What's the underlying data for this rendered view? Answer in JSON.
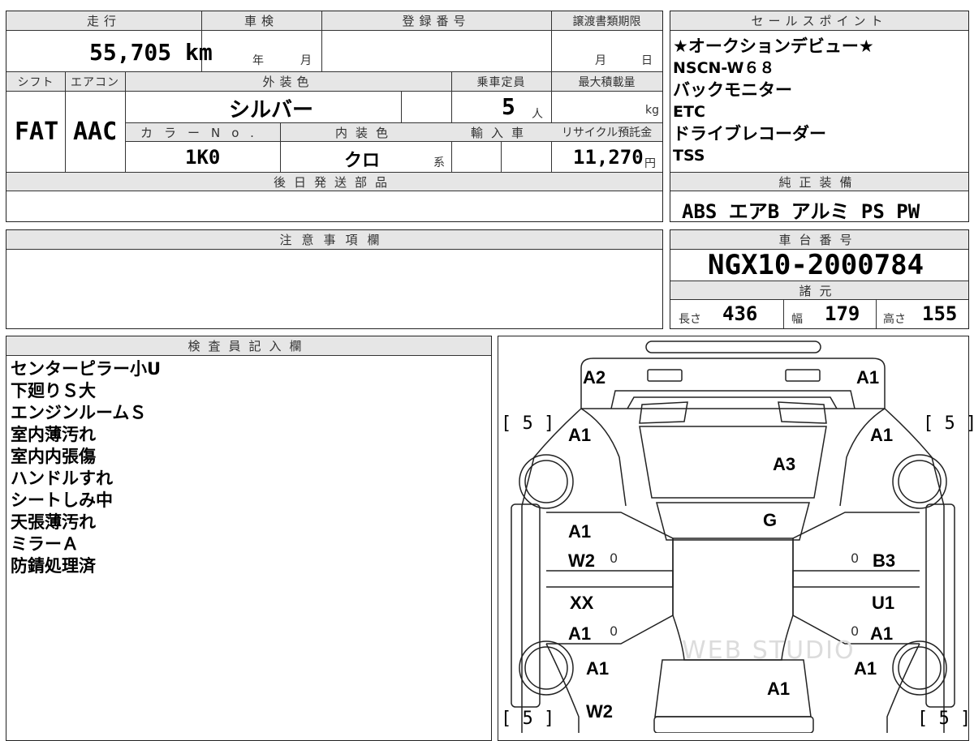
{
  "top": {
    "mileage_header": "走行",
    "shaken_header": "車検",
    "registration_header": "登録番号",
    "transfer_deadline_header": "譲渡書類期限",
    "mileage_value": "55,705 km",
    "shaken_year": "年",
    "shaken_month": "月",
    "transfer_month": "月",
    "transfer_day": "日",
    "shift_header": "シフト",
    "aircon_header": "エアコン",
    "exterior_color_header": "外装色",
    "capacity_header": "乗車定員",
    "max_load_header": "最大積載量",
    "shift_value": "FAT",
    "aircon_value": "AAC",
    "exterior_color_value": "シルバー",
    "capacity_value": "5",
    "capacity_unit": "人",
    "max_load_unit": "kg",
    "color_no_header": "カラーNo.",
    "interior_color_header": "内装色",
    "import_header": "輸入車",
    "recycle_header": "リサイクル預託金",
    "color_no_value": "1K0",
    "interior_color_value": "クロ",
    "interior_color_suffix": "系",
    "recycle_value": "11,270",
    "recycle_unit": "円",
    "later_parts_header": "後日発送部品"
  },
  "sales_points": {
    "header": "セールスポイント",
    "items": [
      "★オークションデビュー★",
      "NSCN-W６８",
      "バックモニター",
      "ETC",
      "ドライブレコーダー",
      "TSS"
    ]
  },
  "equipment": {
    "header": "純正装備",
    "value": "ABS エアB アルミ PS PW"
  },
  "notes": {
    "header": "注意事項欄"
  },
  "chassis": {
    "header": "車台番号",
    "value": "NGX10-2000784",
    "specs_header": "諸元",
    "length_label": "長さ",
    "length_value": "436",
    "width_label": "幅",
    "width_value": "179",
    "height_label": "高さ",
    "height_value": "155"
  },
  "inspector": {
    "header": "検査員記入欄",
    "lines": [
      "センターピラー小U",
      "下廻りＳ大",
      "エンジンルームＳ",
      "室内薄汚れ",
      "室内内張傷",
      "ハンドルすれ",
      "シートしみ中",
      "天張薄汚れ",
      "ミラーＡ",
      "防錆処理済"
    ]
  },
  "diagram": {
    "front_left": "A2",
    "front_right": "A1",
    "fender_fl": "A1",
    "fender_fr": "A1",
    "hood": "A3",
    "windshield": "G",
    "door_fl_1": "A1",
    "door_fl_2": "W2",
    "door_fr": "B3",
    "door_rl_1": "XX",
    "door_rl_2": "A1",
    "door_rr_1": "U1",
    "door_rr_2": "A1",
    "quarter_rl": "A1",
    "quarter_rr": "A1",
    "roof": "A1",
    "rear_left": "W2",
    "tire_fl": "[ 5 ]",
    "tire_fr": "[ 5 ]",
    "tire_rl": "[ 5 ]",
    "tire_rr": "[ 5 ]",
    "zero_fl": "0",
    "zero_fr": "0",
    "zero_rl": "0",
    "zero_rr": "0",
    "watermark": "WEB STUDIO"
  }
}
